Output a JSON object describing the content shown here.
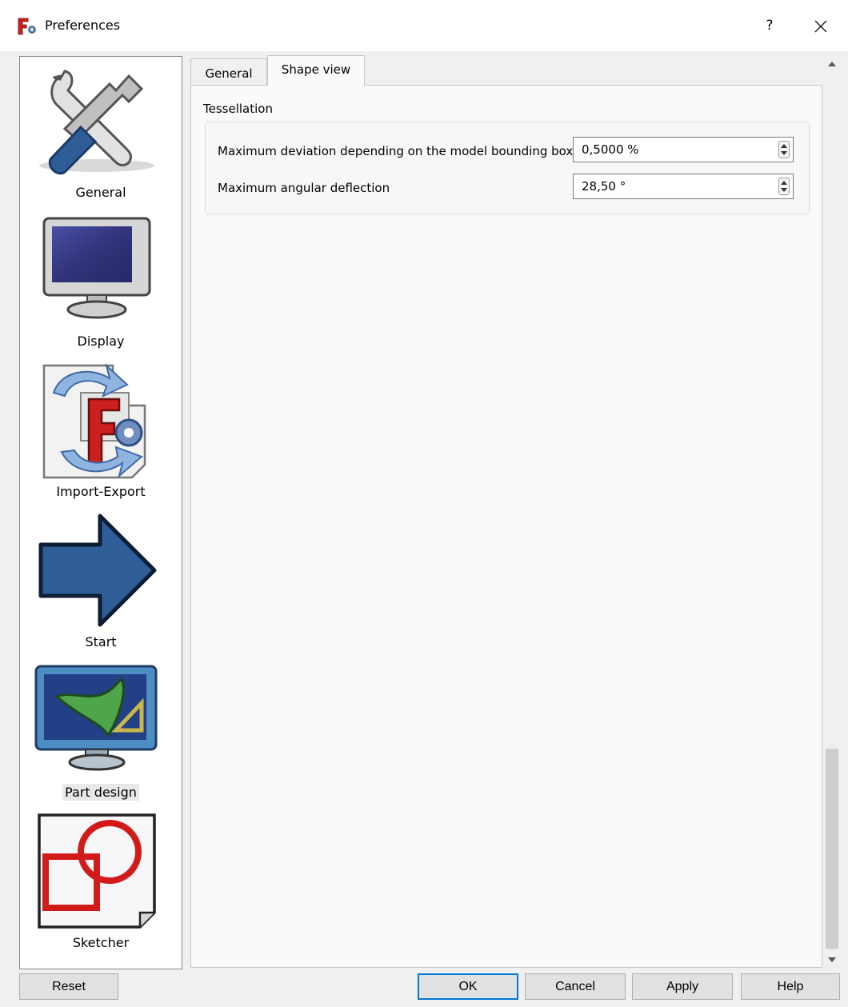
{
  "window": {
    "title": "Preferences",
    "help_label": "?",
    "close_label": "✕"
  },
  "sidebar": {
    "items": [
      {
        "label": "General",
        "icon": "general-tools-icon"
      },
      {
        "label": "Display",
        "icon": "display-monitor-icon"
      },
      {
        "label": "Import-Export",
        "icon": "import-export-icon"
      },
      {
        "label": "Start",
        "icon": "start-arrow-icon"
      },
      {
        "label": "Part design",
        "icon": "part-design-icon",
        "selected": true
      },
      {
        "label": "Sketcher",
        "icon": "sketcher-icon"
      }
    ]
  },
  "tabs": [
    {
      "label": "General",
      "active": false
    },
    {
      "label": "Shape view",
      "active": true
    }
  ],
  "tessellation": {
    "title": "Tessellation",
    "deviation_label": "Maximum deviation depending on the model bounding box",
    "deviation_value": "0,5000 %",
    "angular_label": "Maximum angular deflection",
    "angular_value": "28,50 °"
  },
  "buttons": {
    "reset": "Reset",
    "ok": "OK",
    "cancel": "Cancel",
    "apply": "Apply",
    "help": "Help"
  },
  "colors": {
    "accent_default_button": "#0078d7",
    "logo_red": "#cc1f1f",
    "arrow_blue": "#2e5d98"
  }
}
